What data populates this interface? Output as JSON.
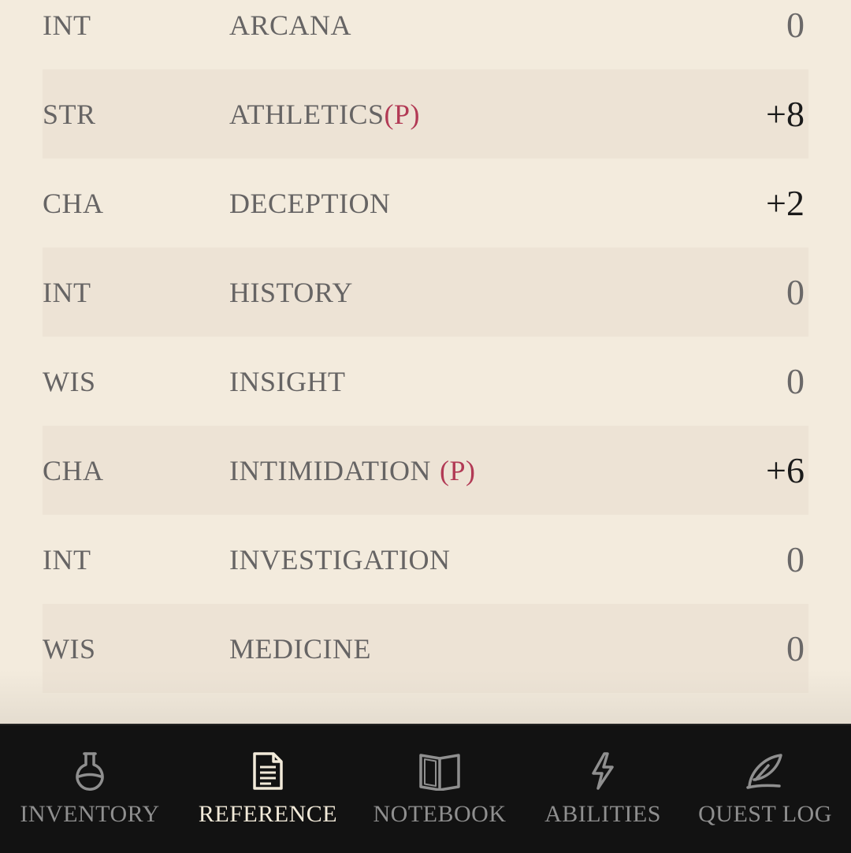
{
  "skills": [
    {
      "ability": "INT",
      "name": "ARCANA",
      "prof": "",
      "modifier": "0"
    },
    {
      "ability": "STR",
      "name": "ATHLETICS",
      "prof": "(P)",
      "modifier": "+8"
    },
    {
      "ability": "CHA",
      "name": "DECEPTION",
      "prof": "",
      "modifier": "+2"
    },
    {
      "ability": "INT",
      "name": "HISTORY",
      "prof": "",
      "modifier": "0"
    },
    {
      "ability": "WIS",
      "name": "INSIGHT",
      "prof": "",
      "modifier": "0"
    },
    {
      "ability": "CHA",
      "name": "INTIMIDATION",
      "prof": "(P)",
      "modifier": "+6"
    },
    {
      "ability": "INT",
      "name": "INVESTIGATION",
      "prof": "",
      "modifier": "0"
    },
    {
      "ability": "WIS",
      "name": "MEDICINE",
      "prof": "",
      "modifier": "0"
    }
  ],
  "tabs": [
    {
      "label": "INVENTORY",
      "icon": "flask-icon",
      "active": false
    },
    {
      "label": "REFERENCE",
      "icon": "document-icon",
      "active": true
    },
    {
      "label": "NOTEBOOK",
      "icon": "book-icon",
      "active": false
    },
    {
      "label": "ABILITIES",
      "icon": "lightning-icon",
      "active": false
    },
    {
      "label": "QUEST LOG",
      "icon": "quill-icon",
      "active": false
    }
  ],
  "colors": {
    "background": "#f3ebdd",
    "row_shaded": "#ede3d5",
    "proficiency": "#b23a55",
    "tabbar": "#121212",
    "tab_active": "#f2ead9",
    "tab_inactive": "#8f8f8f"
  }
}
